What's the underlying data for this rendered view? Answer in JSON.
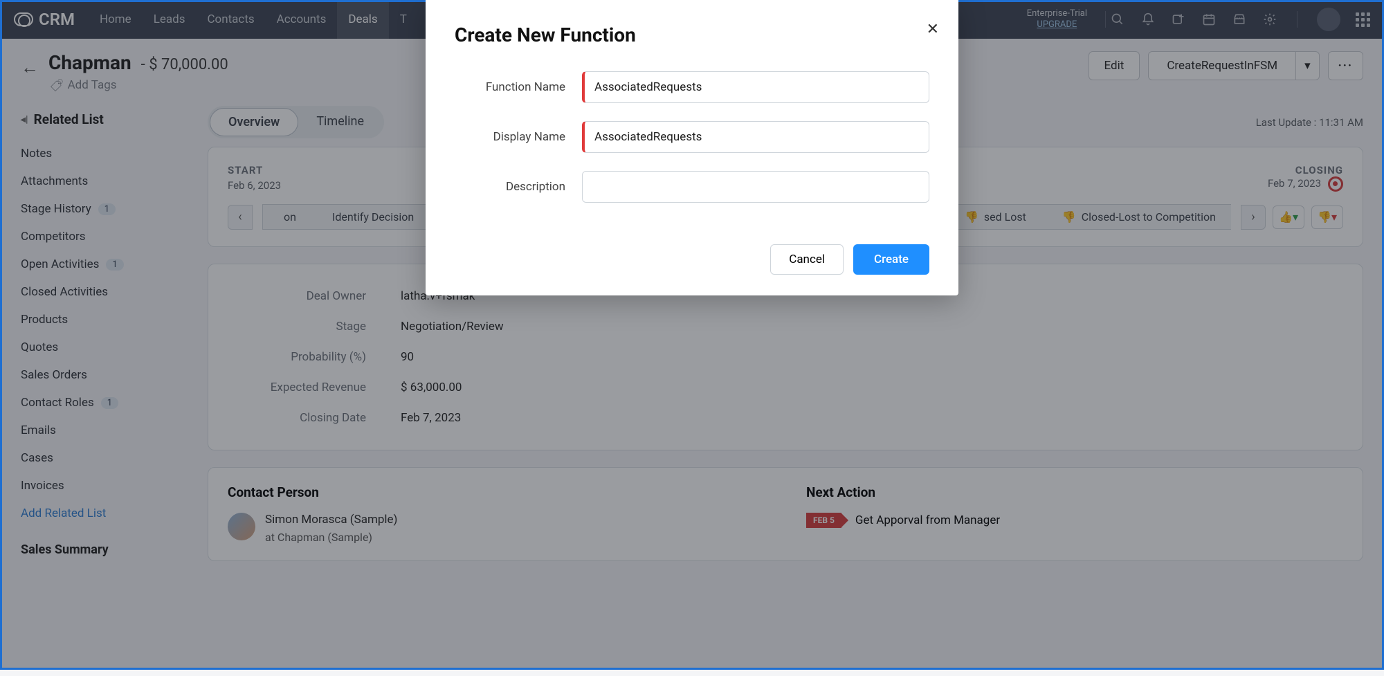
{
  "topnav": {
    "brand": "CRM",
    "tabs": [
      "Home",
      "Leads",
      "Contacts",
      "Accounts",
      "Deals",
      "T"
    ],
    "active_tab_index": 4,
    "upgrade_line1": "Enterprise-Trial",
    "upgrade_line2": "UPGRADE"
  },
  "record": {
    "title": "Chapman",
    "amount": "- $ 70,000.00",
    "add_tags": "Add Tags",
    "edit_label": "Edit",
    "action_button": "CreateRequestInFSM",
    "last_update": "Last Update : 11:31 AM"
  },
  "sidebar": {
    "header": "Related List",
    "items": [
      {
        "label": "Notes"
      },
      {
        "label": "Attachments"
      },
      {
        "label": "Stage History",
        "badge": "1"
      },
      {
        "label": "Competitors"
      },
      {
        "label": "Open Activities",
        "badge": "1"
      },
      {
        "label": "Closed Activities"
      },
      {
        "label": "Products"
      },
      {
        "label": "Quotes"
      },
      {
        "label": "Sales Orders"
      },
      {
        "label": "Contact Roles",
        "badge": "1"
      },
      {
        "label": "Emails"
      },
      {
        "label": "Cases"
      },
      {
        "label": "Invoices"
      }
    ],
    "add_link": "Add Related List",
    "section2": "Sales Summary"
  },
  "tabs": {
    "overview": "Overview",
    "timeline": "Timeline"
  },
  "stage": {
    "start_label": "START",
    "start_date": "Feb 6, 2023",
    "closing_label": "CLOSING",
    "closing_date": "Feb 7, 2023",
    "chevrons": [
      "on",
      "Identify Decision",
      "sed Lost",
      "Closed-Lost to Competition"
    ]
  },
  "details": [
    {
      "label": "Deal Owner",
      "value": "latha.v+fsmak"
    },
    {
      "label": "Stage",
      "value": "Negotiation/Review"
    },
    {
      "label": "Probability (%)",
      "value": "90"
    },
    {
      "label": "Expected Revenue",
      "value": "$ 63,000.00"
    },
    {
      "label": "Closing Date",
      "value": "Feb 7, 2023"
    }
  ],
  "lower": {
    "contact_title": "Contact Person",
    "contact_name": "Simon Morasca (Sample)",
    "contact_company": "at Chapman (Sample)",
    "action_title": "Next Action",
    "action_date": "FEB 5",
    "action_text": "Get Apporval from Manager"
  },
  "modal": {
    "title": "Create New Function",
    "fn_label": "Function Name",
    "fn_value": "AssociatedRequests",
    "dn_label": "Display Name",
    "dn_value": "AssociatedRequests",
    "desc_label": "Description",
    "desc_value": "",
    "cancel": "Cancel",
    "create": "Create"
  }
}
